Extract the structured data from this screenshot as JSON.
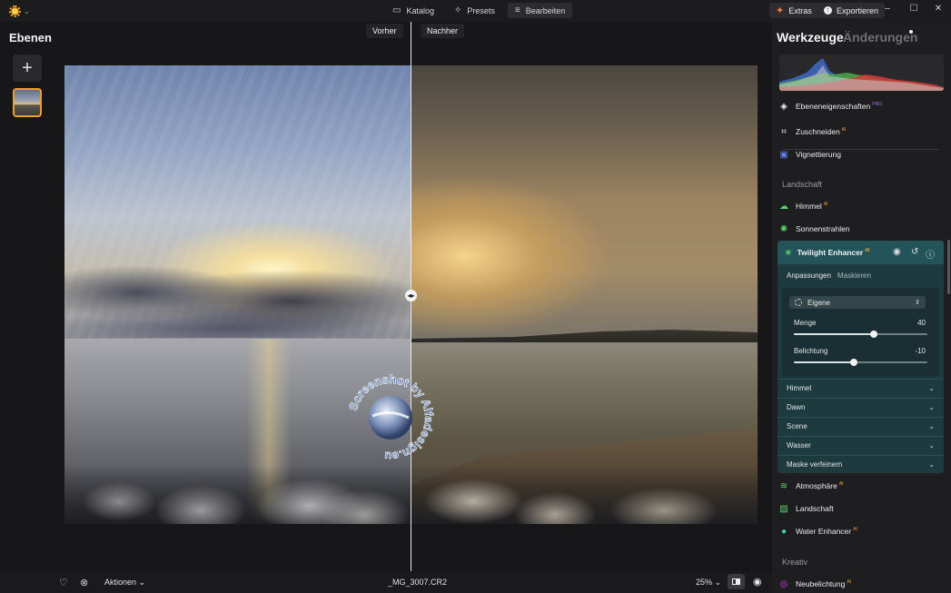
{
  "topbar": {
    "tabs": [
      {
        "label": "Katalog",
        "icon": "folder-icon"
      },
      {
        "label": "Presets",
        "icon": "sparkle-icon"
      },
      {
        "label": "Bearbeiten",
        "icon": "sliders-icon"
      }
    ],
    "active_tab": "Bearbeiten",
    "extras_label": "Extras",
    "export_label": "Exportieren",
    "accent_color": "#f29c1f"
  },
  "left_panel": {
    "title": "Ebenen"
  },
  "canvas": {
    "before_label": "Vorher",
    "after_label": "Nachher",
    "watermark_text": "Screenshot by Alfadesign.eu"
  },
  "bottombar": {
    "actions_label": "Aktionen",
    "filename": "_MG_3007.CR2",
    "zoom": "25%"
  },
  "right_panel": {
    "title": "Werkzeuge",
    "title_secondary": "Änderungen",
    "tools_top": [
      {
        "label": "Ebeneneigenschaften",
        "badge": "PRO",
        "icon": "layers-icon"
      },
      {
        "label": "Zuschneiden",
        "badge": "AI",
        "icon": "crop-icon"
      },
      {
        "label": "Vignettierung",
        "badge": "",
        "icon": "vignette-icon"
      }
    ],
    "section_landschaft": "Landschaft",
    "landscape_tools": [
      {
        "label": "Himmel",
        "badge": "AI",
        "icon": "cloud-icon"
      },
      {
        "label": "Sonnenstrahlen",
        "badge": "",
        "icon": "sunrays-icon"
      }
    ],
    "twilight": {
      "title": "Twilight Enhancer",
      "badge": "AI",
      "tab_adjust": "Anpassungen",
      "tab_mask": "Maskieren",
      "preset": "Eigene",
      "sliders": [
        {
          "label": "Menge",
          "value": "40",
          "fraction": 0.6
        },
        {
          "label": "Belichtung",
          "value": "-10",
          "fraction": 0.45
        }
      ],
      "sections": [
        "Himmel",
        "Dawn",
        "Scene",
        "Wasser",
        "Maske verfeinern"
      ],
      "header_color": "#22545a"
    },
    "landscape_tools_bottom": [
      {
        "label": "Atmosphäre",
        "badge": "AI",
        "icon": "atmosphere-icon"
      },
      {
        "label": "Landschaft",
        "badge": "",
        "icon": "landscape-icon"
      },
      {
        "label": "Water Enhancer",
        "badge": "AI",
        "icon": "water-drop-icon"
      }
    ],
    "section_kreativ": "Kreativ",
    "kreativ_tools": [
      {
        "label": "Neubelichtung",
        "badge": "AI",
        "icon": "relight-icon"
      }
    ]
  }
}
